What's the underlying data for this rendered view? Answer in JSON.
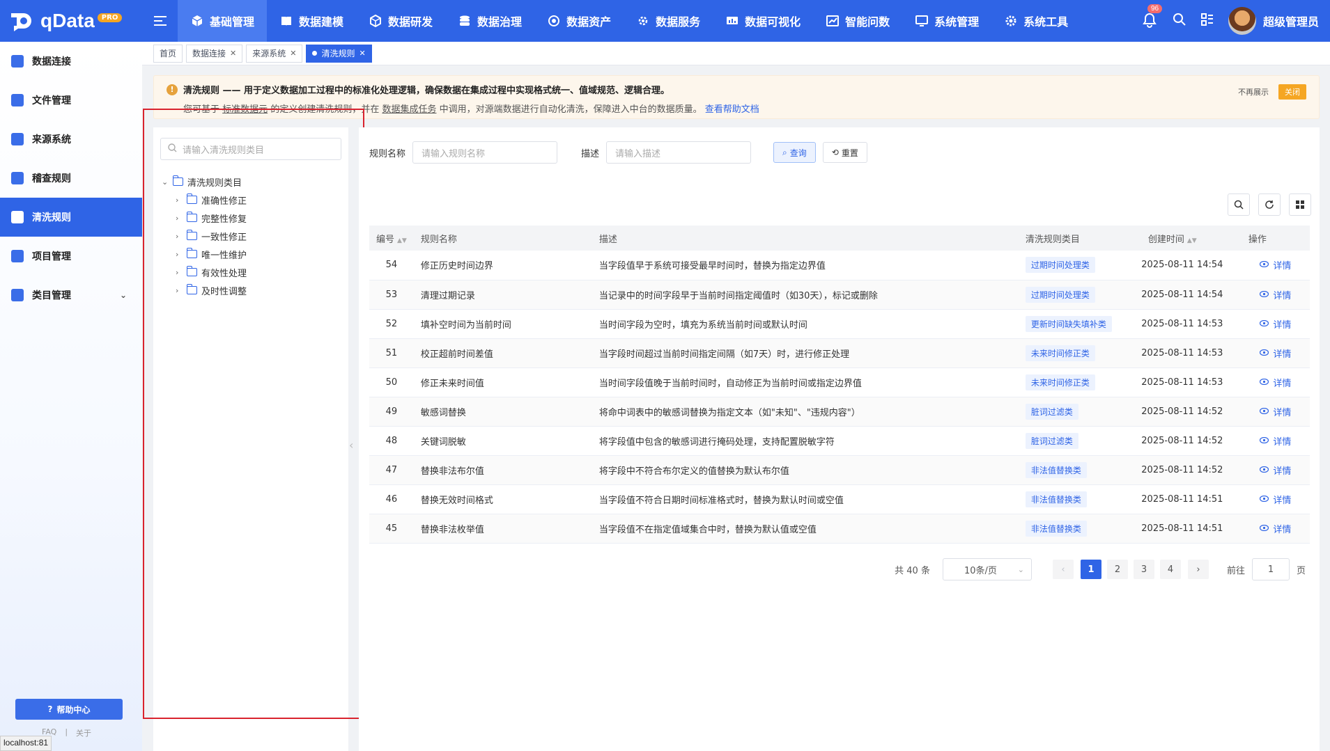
{
  "app": {
    "logo_text": "qData",
    "logo_badge": "PRO",
    "notification_count": "96",
    "user_name": "超级管理员"
  },
  "topnav": [
    {
      "label": "基础管理",
      "icon": "cube-icon",
      "active": true
    },
    {
      "label": "数据建模",
      "icon": "book-icon"
    },
    {
      "label": "数据研发",
      "icon": "package-icon"
    },
    {
      "label": "数据治理",
      "icon": "database-icon"
    },
    {
      "label": "数据资产",
      "icon": "target-icon"
    },
    {
      "label": "数据服务",
      "icon": "gear-service-icon"
    },
    {
      "label": "数据可视化",
      "icon": "chart-icon"
    },
    {
      "label": "智能问数",
      "icon": "ai-chart-icon"
    },
    {
      "label": "系统管理",
      "icon": "monitor-icon"
    },
    {
      "label": "系统工具",
      "icon": "cog-icon"
    }
  ],
  "sidebar": {
    "items": [
      {
        "label": "数据连接"
      },
      {
        "label": "文件管理"
      },
      {
        "label": "来源系统"
      },
      {
        "label": "稽查规则"
      },
      {
        "label": "清洗规则",
        "active": true
      },
      {
        "label": "项目管理"
      },
      {
        "label": "类目管理",
        "has_chevron": true
      }
    ],
    "help_label": "帮助中心",
    "faq_label": "FAQ",
    "about_label": "关于",
    "status_url": "localhost:81"
  },
  "tabs": [
    {
      "label": "首页"
    },
    {
      "label": "数据连接",
      "closable": true
    },
    {
      "label": "来源系统",
      "closable": true
    },
    {
      "label": "清洗规则",
      "closable": true,
      "active": true
    }
  ],
  "notice": {
    "line1": "清洗规则 —— 用于定义数据加工过程中的标准化处理逻辑，确保数据在集成过程中实现格式统一、值域规范、逻辑合理。",
    "line2_a": "您可基于",
    "line2_link1": "标准数据元",
    "line2_b": "的定义创建清洗规则，并在",
    "line2_link2": "数据集成任务",
    "line2_c": "中调用，对源端数据进行自动化清洗，保障进入中台的数据质量。",
    "help_link": "查看帮助文档",
    "no_more": "不再展示",
    "close": "关闭"
  },
  "tree": {
    "search_placeholder": "请输入清洗规则类目",
    "root": "清洗规则类目",
    "children": [
      "准确性修正",
      "完整性修复",
      "一致性修正",
      "唯一性维护",
      "有效性处理",
      "及时性调整"
    ]
  },
  "filters": {
    "name_label": "规则名称",
    "name_placeholder": "请输入规则名称",
    "desc_label": "描述",
    "desc_placeholder": "请输入描述",
    "query_btn": "查询",
    "reset_btn": "重置"
  },
  "table": {
    "headers": [
      "编号",
      "规则名称",
      "描述",
      "清洗规则类目",
      "创建时间",
      "操作"
    ],
    "detail_label": "详情",
    "rows": [
      {
        "id": "54",
        "name": "修正历史时间边界",
        "desc": "当字段值早于系统可接受最早时间时，替换为指定边界值",
        "category": "过期时间处理类",
        "time": "2025-08-11 14:54"
      },
      {
        "id": "53",
        "name": "清理过期记录",
        "desc": "当记录中的时间字段早于当前时间指定阈值时（如30天），标记或删除",
        "category": "过期时间处理类",
        "time": "2025-08-11 14:54"
      },
      {
        "id": "52",
        "name": "填补空时间为当前时间",
        "desc": "当时间字段为空时，填充为系统当前时间或默认时间",
        "category": "更新时间缺失填补类",
        "time": "2025-08-11 14:53"
      },
      {
        "id": "51",
        "name": "校正超前时间差值",
        "desc": "当字段时间超过当前时间指定间隔（如7天）时，进行修正处理",
        "category": "未来时间修正类",
        "time": "2025-08-11 14:53"
      },
      {
        "id": "50",
        "name": "修正未来时间值",
        "desc": "当时间字段值晚于当前时间时，自动修正为当前时间或指定边界值",
        "category": "未来时间修正类",
        "time": "2025-08-11 14:53"
      },
      {
        "id": "49",
        "name": "敏感词替换",
        "desc": "将命中词表中的敏感词替换为指定文本（如\"未知\"、\"违规内容\"）",
        "category": "脏词过滤类",
        "time": "2025-08-11 14:52"
      },
      {
        "id": "48",
        "name": "关键词脱敏",
        "desc": "将字段值中包含的敏感词进行掩码处理，支持配置脱敏字符",
        "category": "脏词过滤类",
        "time": "2025-08-11 14:52"
      },
      {
        "id": "47",
        "name": "替换非法布尔值",
        "desc": "将字段中不符合布尔定义的值替换为默认布尔值",
        "category": "非法值替换类",
        "time": "2025-08-11 14:52"
      },
      {
        "id": "46",
        "name": "替换无效时间格式",
        "desc": "当字段值不符合日期时间标准格式时，替换为默认时间或空值",
        "category": "非法值替换类",
        "time": "2025-08-11 14:51"
      },
      {
        "id": "45",
        "name": "替换非法枚举值",
        "desc": "当字段值不在指定值域集合中时，替换为默认值或空值",
        "category": "非法值替换类",
        "time": "2025-08-11 14:51"
      }
    ]
  },
  "pagination": {
    "total": "共 40 条",
    "page_size": "10条/页",
    "pages": [
      "1",
      "2",
      "3",
      "4"
    ],
    "current": "1",
    "goto_label": "前往",
    "goto_value": "1",
    "page_suffix": "页"
  },
  "colors": {
    "primary": "#2f64e6",
    "warning": "#f5a623",
    "highlight_box": "#d9232e"
  }
}
